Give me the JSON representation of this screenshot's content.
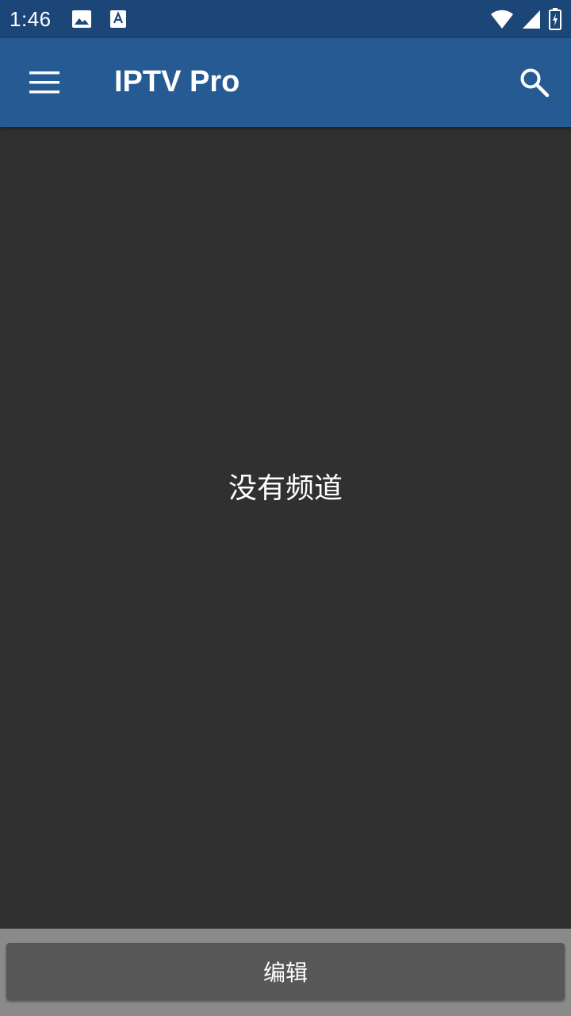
{
  "status_bar": {
    "time": "1:46",
    "left_icons": [
      "image-icon",
      "font-icon"
    ],
    "right_icons": [
      "wifi-icon",
      "cell-signal-icon",
      "battery-icon"
    ]
  },
  "app_bar": {
    "title": "IPTV Pro",
    "menu_icon": "hamburger-menu-icon",
    "search_icon": "search-icon",
    "background": "#255a93"
  },
  "main": {
    "empty_message": "没有频道"
  },
  "footer": {
    "edit_button_label": "编辑"
  },
  "colors": {
    "status_bar": "#1c4677",
    "app_bar": "#255a93",
    "content_bg": "#303030",
    "button_bg": "#575757"
  }
}
